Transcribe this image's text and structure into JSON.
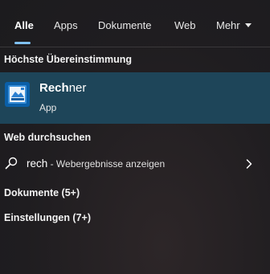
{
  "tabs": [
    {
      "label": "Alle",
      "active": true
    },
    {
      "label": "Apps"
    },
    {
      "label": "Dokumente"
    },
    {
      "label": "Web"
    },
    {
      "label": "Mehr"
    }
  ],
  "best_match": {
    "section_title": "Höchste Übereinstimmung",
    "app_name_bold": "Rech",
    "app_name_rest": "ner",
    "app_type": "App",
    "icon": "calculator-icon"
  },
  "web": {
    "section_title": "Web durchsuchen",
    "query": "rech",
    "suffix": " - Webergebnisse anzeigen",
    "icon": "search-icon"
  },
  "categories": [
    {
      "label": "Dokumente (5+)"
    },
    {
      "label": "Einstellungen (7+)"
    }
  ],
  "colors": {
    "accent": "#7fc0f0",
    "selected_background": "#1e4559",
    "background": "#201e20"
  }
}
